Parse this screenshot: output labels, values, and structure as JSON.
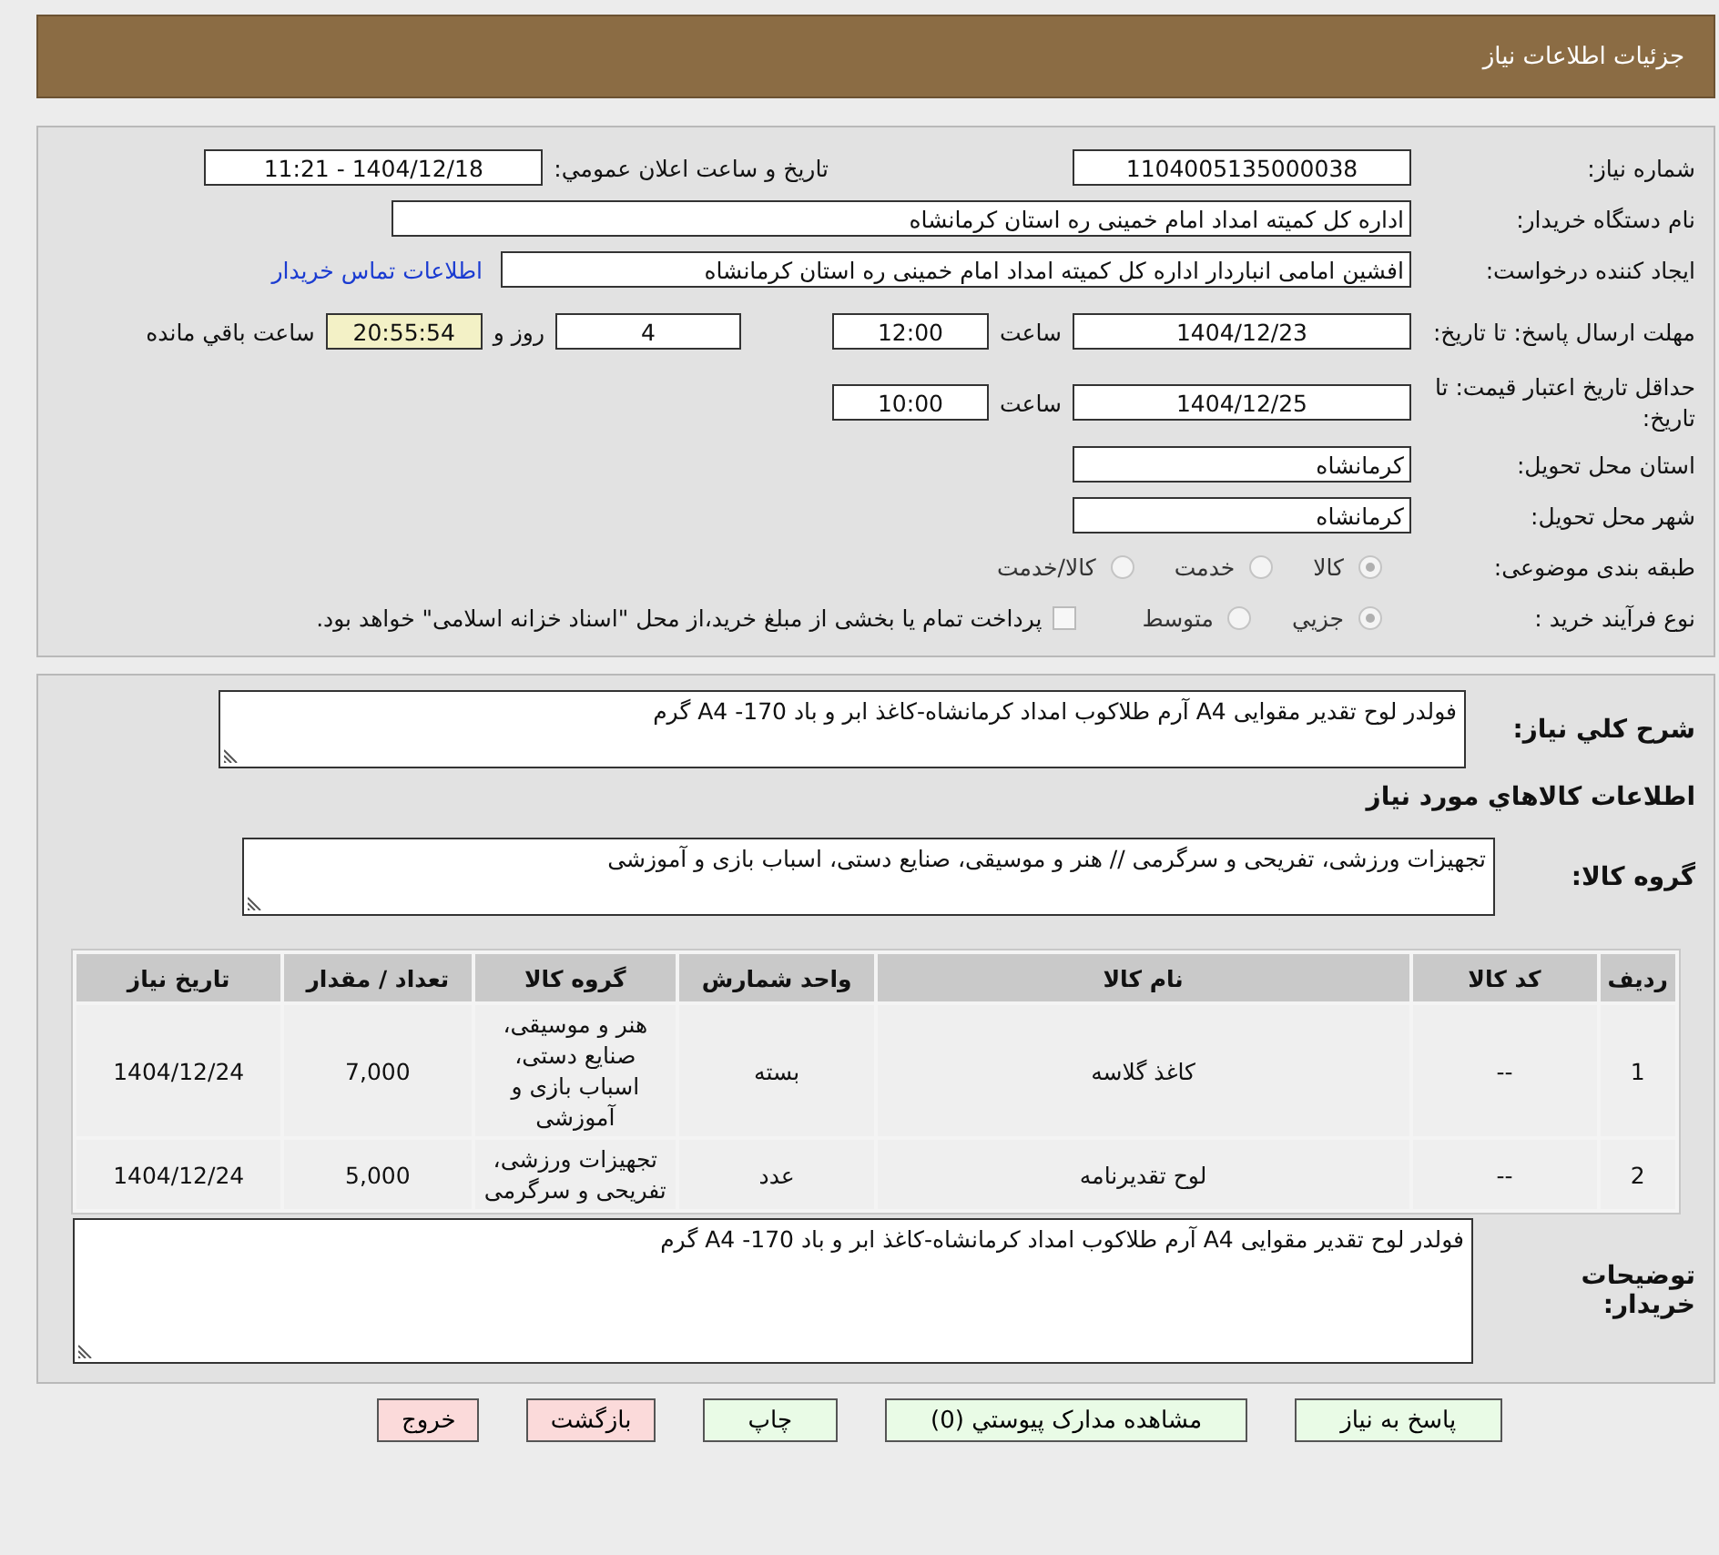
{
  "header": {
    "title": "جزئیات اطلاعات نیاز"
  },
  "need_number": {
    "label": "شماره نیاز:",
    "value": "1104005135000038"
  },
  "announce": {
    "label": "تاريخ و ساعت اعلان عمومي:",
    "value": "1404/12/18 - 11:21"
  },
  "buyer_org": {
    "label": "نام دستگاه خریدار:",
    "value": "اداره کل کمیته امداد امام خمینی  ره  استان کرمانشاه"
  },
  "requester": {
    "label": "ایجاد کننده درخواست:",
    "value": "افشین امامی انباردار اداره کل کمیته امداد امام خمینی  ره  استان کرمانشاه",
    "link": "اطلاعات تماس خریدار"
  },
  "deadline": {
    "label": "مهلت ارسال پاسخ: تا تاریخ:",
    "date": "1404/12/23",
    "time_label": "ساعت",
    "time": "12:00",
    "days": "4",
    "days_label": "روز و",
    "remaining": "20:55:54",
    "remaining_label": "ساعت باقي مانده"
  },
  "validity": {
    "label": "حداقل تاریخ اعتبار قیمت: تا تاریخ:",
    "date": "1404/12/25",
    "time_label": "ساعت",
    "time": "10:00"
  },
  "province": {
    "label": "استان محل تحویل:",
    "value": "کرمانشاه"
  },
  "city": {
    "label": "شهر محل تحویل:",
    "value": "کرمانشاه"
  },
  "category": {
    "label": "طبقه بندی موضوعی:",
    "options": [
      {
        "label": "کالا",
        "selected": true,
        "disabled": true
      },
      {
        "label": "خدمت",
        "selected": false,
        "disabled": true
      },
      {
        "label": "کالا/خدمت",
        "selected": false,
        "disabled": true
      }
    ]
  },
  "process": {
    "label": "نوع فرآیند خرید :",
    "options": [
      {
        "label": "جزيي",
        "selected": true,
        "disabled": true
      },
      {
        "label": "متوسط",
        "selected": false,
        "disabled": true
      }
    ],
    "payment": {
      "checked": false,
      "text": "پرداخت تمام یا بخشی از مبلغ خرید،از محل \"اسناد خزانه اسلامی\" خواهد بود."
    }
  },
  "summary": {
    "label": "شرح کلي نیاز:",
    "value": "فولدر لوح تقدیر مقوایی A4 آرم طلاکوب امداد کرمانشاه-کاغذ ابر و باد 170- A4 گرم"
  },
  "goods_heading": "اطلاعات کالاهاي مورد نیاز",
  "goods_group": {
    "label": "گروه کالا:",
    "value": "تجهیزات ورزشی، تفریحی و سرگرمی // هنر و موسیقی، صنایع دستی، اسباب بازی و آموزشی"
  },
  "table": {
    "columns": [
      "ردیف",
      "کد کالا",
      "نام کالا",
      "واحد شمارش",
      "گروه کالا",
      "تعداد / مقدار",
      "تاریخ نیاز"
    ],
    "rows": [
      [
        "1",
        "--",
        "کاغذ گلاسه",
        "بسته",
        "هنر و موسیقی، صنایع دستی، اسباب بازی و آموزشی",
        "7,000",
        "1404/12/24"
      ],
      [
        "2",
        "--",
        "لوح تقدیرنامه",
        "عدد",
        "تجهیزات ورزشی، تفریحی و سرگرمی",
        "5,000",
        "1404/12/24"
      ]
    ]
  },
  "buyer_notes": {
    "label": "توضیحات خریدار:",
    "value": "فولدر لوح تقدیر مقوایی A4 آرم طلاکوب امداد کرمانشاه-کاغذ ابر و باد 170- A4 گرم"
  },
  "buttons": [
    {
      "label": "پاسخ به نیاز",
      "kind": "normal"
    },
    {
      "label": "مشاهده مدارک پیوستي (0)",
      "kind": "normal"
    },
    {
      "label": "چاپ",
      "kind": "normal"
    },
    {
      "label": "بازگشت",
      "kind": "danger"
    },
    {
      "label": "خروج",
      "kind": "danger"
    }
  ]
}
